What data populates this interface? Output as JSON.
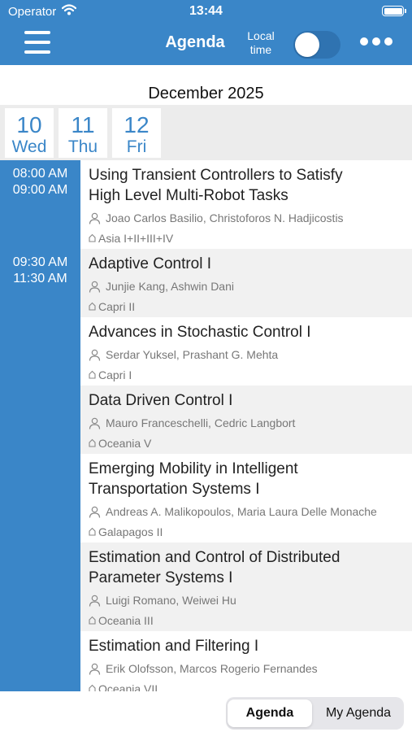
{
  "status_bar": {
    "carrier": "Operator",
    "time": "13:44"
  },
  "nav": {
    "title": "Agenda",
    "local_time_line1": "Local",
    "local_time_line2": "time",
    "local_time_enabled": true
  },
  "month_label": "December 2025",
  "dates": [
    {
      "num": "10",
      "day": "Wed",
      "selected": true
    },
    {
      "num": "11",
      "day": "Thu",
      "selected": false
    },
    {
      "num": "12",
      "day": "Fri",
      "selected": false
    }
  ],
  "time_slots": [
    {
      "start": "08:00 AM",
      "end": "09:00 AM"
    },
    {
      "start": "09:30 AM",
      "end": "11:30 AM"
    }
  ],
  "sessions": [
    {
      "title_line1": "Using Transient Controllers to Satisfy",
      "title_line2": "High Level Multi-Robot Tasks",
      "authors": "Joao Carlos Basilio, Christoforos N. Hadjicostis",
      "room": "Asia I+II+III+IV"
    },
    {
      "title_line1": "Adaptive Control I",
      "authors": "Junjie Kang, Ashwin Dani",
      "room": "Capri II"
    },
    {
      "title_line1": "Advances in Stochastic Control I",
      "authors": "Serdar Yuksel, Prashant G. Mehta",
      "room": "Capri I"
    },
    {
      "title_line1": "Data Driven Control I",
      "authors": "Mauro Franceschelli, Cedric Langbort",
      "room": "Oceania V"
    },
    {
      "title_line1": "Emerging Mobility in Intelligent",
      "title_line2": "Transportation Systems I",
      "authors": "Andreas A. Malikopoulos, Maria Laura Delle Monache",
      "room": "Galapagos II"
    },
    {
      "title_line1": "Estimation and Control of Distributed",
      "title_line2": "Parameter Systems I",
      "authors": "Luigi Romano, Weiwei Hu",
      "room": "Oceania III"
    },
    {
      "title_line1": "Estimation and Filtering I",
      "authors": "Erik Olofsson, Marcos Rogerio Fernandes",
      "room": "Oceania VII"
    }
  ],
  "tabs": {
    "agenda": "Agenda",
    "my_agenda": "My Agenda",
    "active": "agenda"
  },
  "colors": {
    "accent": "#3a86c8",
    "alt_row": "#f1f1f1",
    "strip_bg": "#ececec"
  }
}
